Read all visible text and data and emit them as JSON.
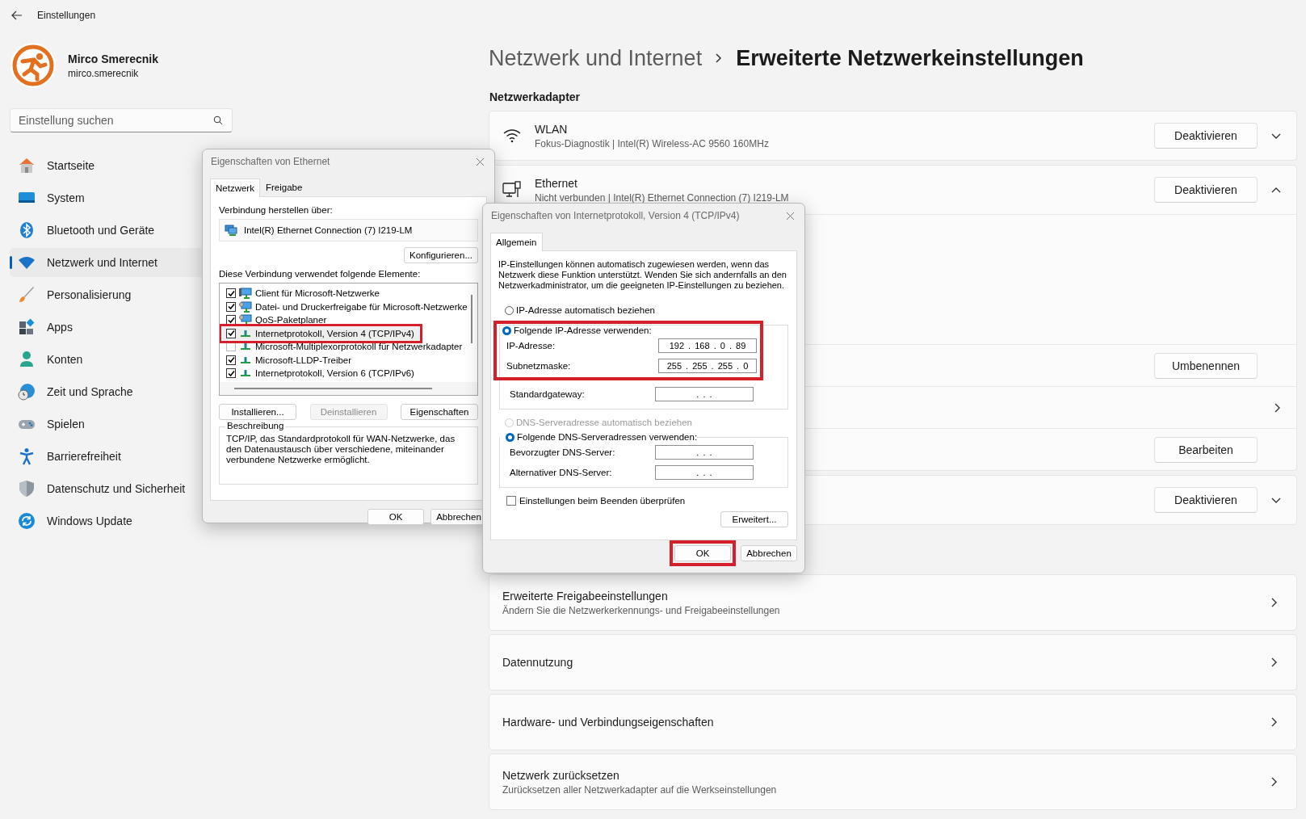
{
  "window": {
    "title": "Einstellungen"
  },
  "profile": {
    "name": "Mirco Smerecnik",
    "account": "mirco.smerecnik"
  },
  "search": {
    "placeholder": "Einstellung suchen"
  },
  "sidebar": {
    "items": [
      {
        "label": "Startseite",
        "selected": false
      },
      {
        "label": "System",
        "selected": false
      },
      {
        "label": "Bluetooth und Geräte",
        "selected": false
      },
      {
        "label": "Netzwerk und Internet",
        "selected": true
      },
      {
        "label": "Personalisierung",
        "selected": false
      },
      {
        "label": "Apps",
        "selected": false
      },
      {
        "label": "Konten",
        "selected": false
      },
      {
        "label": "Zeit und Sprache",
        "selected": false
      },
      {
        "label": "Spielen",
        "selected": false
      },
      {
        "label": "Barrierefreiheit",
        "selected": false
      },
      {
        "label": "Datenschutz und Sicherheit",
        "selected": false
      },
      {
        "label": "Windows Update",
        "selected": false
      }
    ]
  },
  "breadcrumb": {
    "parent": "Netzwerk und Internet",
    "current": "Erweiterte Netzwerkeinstellungen"
  },
  "adapters": {
    "heading": "Netzwerkadapter",
    "items": [
      {
        "kind": "wifi",
        "name": "WLAN",
        "detail": "Fokus-Diagnostik | Intel(R) Wireless-AC 9560 160MHz",
        "button": "Deaktivieren",
        "expanded": false
      },
      {
        "kind": "ethernet",
        "name": "Ethernet",
        "detail": "Nicht verbunden | Intel(R) Ethernet Connection (7) I219-LM",
        "button": "Deaktivieren",
        "expanded": true,
        "rows": [
          {
            "kind": "button",
            "button": "Umbenennen"
          },
          {
            "kind": "link"
          },
          {
            "kind": "button",
            "button": "Bearbeiten"
          }
        ]
      },
      {
        "kind": "hidden",
        "button": "Deaktivieren",
        "expanded": false
      }
    ]
  },
  "links": [
    {
      "title": "Erweiterte Freigabeeinstellungen",
      "subtitle": "Ändern Sie die Netzwerkerkennungs- und Freigabeeinstellungen"
    },
    {
      "title": "Datennutzung"
    },
    {
      "title": "Hardware- und Verbindungseigenschaften"
    },
    {
      "title": "Netzwerk zurücksetzen",
      "subtitle": "Zurücksetzen aller Netzwerkadapter auf die Werkseinstellungen"
    }
  ],
  "ethernet_dialog": {
    "title": "Eigenschaften von Ethernet",
    "tabs": [
      {
        "label": "Netzwerk",
        "selected": true
      },
      {
        "label": "Freigabe",
        "selected": false
      }
    ],
    "connect_label": "Verbindung herstellen über:",
    "adapter": "Intel(R) Ethernet Connection (7) I219-LM",
    "configure_button": "Konfigurieren...",
    "elements_label": "Diese Verbindung verwendet folgende Elemente:",
    "elements": [
      {
        "kind": "client",
        "label": "Client für Microsoft-Netzwerke",
        "checked": true,
        "highlighted": false
      },
      {
        "kind": "service",
        "label": "Datei- und Druckerfreigabe für Microsoft-Netzwerke",
        "checked": true,
        "highlighted": false
      },
      {
        "kind": "service",
        "label": "QoS-Paketplaner",
        "checked": true,
        "highlighted": false
      },
      {
        "kind": "protocol",
        "label": "Internetprotokoll, Version 4 (TCP/IPv4)",
        "checked": true,
        "highlighted": true
      },
      {
        "kind": "protocol",
        "label": "Microsoft-Multiplexorprotokoll für Netzwerkadapter",
        "checked": false,
        "highlighted": false
      },
      {
        "kind": "protocol",
        "label": "Microsoft-LLDP-Treiber",
        "checked": true,
        "highlighted": false
      },
      {
        "kind": "protocol",
        "label": "Internetprotokoll, Version 6 (TCP/IPv6)",
        "checked": true,
        "highlighted": false
      }
    ],
    "actions": [
      {
        "label": "Installieren...",
        "disabled": false
      },
      {
        "label": "Deinstallieren",
        "disabled": true
      },
      {
        "label": "Eigenschaften",
        "disabled": false
      }
    ],
    "description": {
      "legend": "Beschreibung",
      "text": "TCP/IP, das Standardprotokoll für WAN-Netzwerke, das den Datenaustausch über verschiedene, miteinander verbundene Netzwerke ermöglicht."
    },
    "ok_button": "OK",
    "cancel_button": "Abbrechen"
  },
  "ipv4_dialog": {
    "title": "Eigenschaften von Internetprotokoll, Version 4 (TCP/IPv4)",
    "tabs": [
      {
        "label": "Allgemein",
        "selected": true
      }
    ],
    "intro": "IP-Einstellungen können automatisch zugewiesen werden, wenn das Netzwerk diese Funktion unterstützt. Wenden Sie sich andernfalls an den Netzwerkadministrator, um die geeigneten IP-Einstellungen zu beziehen.",
    "ip_auto": {
      "label": "IP-Adresse automatisch beziehen",
      "selected": false,
      "disabled": false
    },
    "ip_manual": {
      "label": "Folgende IP-Adresse verwenden:",
      "selected": true,
      "disabled": false,
      "highlighted": true
    },
    "ip_fields": [
      {
        "label": "IP-Adresse:",
        "value": "192 . 168 . 0 . 89"
      },
      {
        "label": "Subnetzmaske:",
        "value": "255 . 255 . 255 . 0"
      },
      {
        "label": "Standardgateway:",
        "value": ". . ."
      }
    ],
    "dns_auto": {
      "label": "DNS-Serveradresse automatisch beziehen",
      "selected": false,
      "disabled": true
    },
    "dns_manual": {
      "label": "Folgende DNS-Serveradressen verwenden:",
      "selected": true,
      "disabled": false
    },
    "dns_fields": [
      {
        "label": "Bevorzugter DNS-Server:",
        "value": ". . ."
      },
      {
        "label": "Alternativer DNS-Server:",
        "value": ". . ."
      }
    ],
    "validate": {
      "label": "Einstellungen beim Beenden überprüfen",
      "checked": false
    },
    "advanced_button": "Erweitert...",
    "ok_button": {
      "label": "OK",
      "highlighted": true
    },
    "cancel_button": "Abbrechen"
  }
}
